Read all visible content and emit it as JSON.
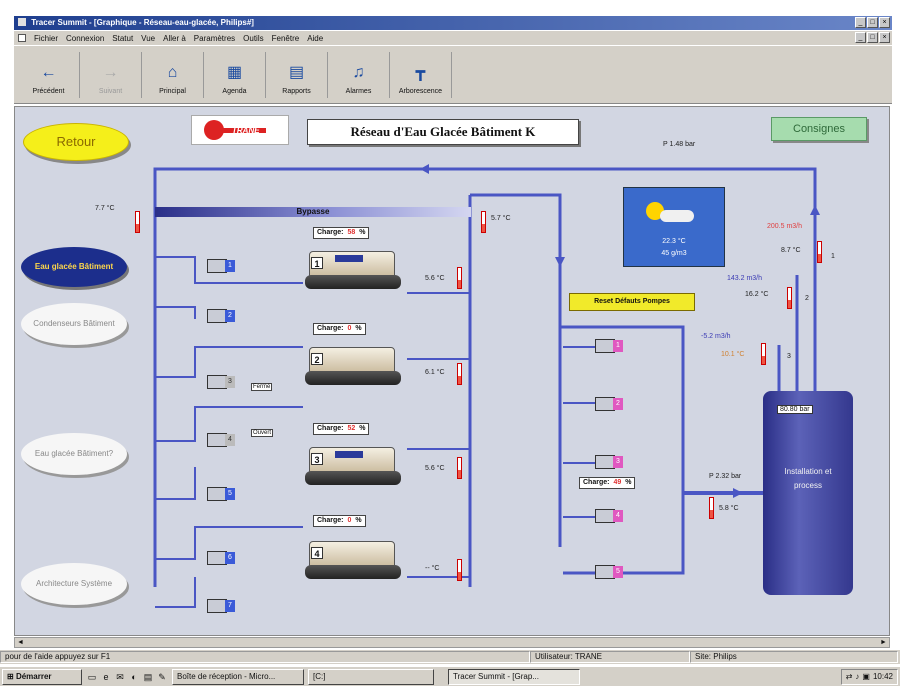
{
  "window": {
    "title": "Tracer Summit - [Graphique - Réseau-eau-glacée, Philips#]",
    "menu": [
      "Fichier",
      "Connexion",
      "Statut",
      "Vue",
      "Aller à",
      "Paramètres",
      "Outils",
      "Fenêtre",
      "Aide"
    ]
  },
  "toolbar": [
    {
      "label": "Précédent",
      "icon": "back-arrow-icon",
      "glyph": "←",
      "enabled": true
    },
    {
      "label": "Suivant",
      "icon": "forward-arrow-icon",
      "glyph": "→",
      "enabled": false
    },
    {
      "label": "Principal",
      "icon": "home-icon",
      "glyph": "⌂",
      "enabled": true
    },
    {
      "label": "Agenda",
      "icon": "agenda-icon",
      "glyph": "▦",
      "enabled": true
    },
    {
      "label": "Rapports",
      "icon": "reports-icon",
      "glyph": "▤",
      "enabled": true
    },
    {
      "label": "Alarmes",
      "icon": "alarm-bell-icon",
      "glyph": "♫",
      "enabled": true
    },
    {
      "label": "Arborescence",
      "icon": "tree-icon",
      "glyph": "┳",
      "enabled": true
    }
  ],
  "nav": {
    "retour": "Retour",
    "eau_glacee_batiment": "Eau glacée Bâtiment",
    "condenseurs_batiment": "Condenseurs Bâtiment",
    "eau_glacee_batiment2": "Eau glacée Bâtiment?",
    "architecture": "Architecture Système"
  },
  "diagram": {
    "logo": "TRANE",
    "title": "Réseau d'Eau Glacée Bâtiment K",
    "consignes": "Consignes",
    "bypass": "Bypasse",
    "reset_button": "Reset Défauts Pompes",
    "top_pressure": "1.48 bar",
    "return_temp": "7.7 °C",
    "supply_temp": "5.7 °C",
    "weather": {
      "temp": "22.3 °C",
      "humidity": "45 g/m3"
    },
    "chillers": [
      {
        "num": "1",
        "charge_label": "Charge:",
        "charge": "58",
        "unit": "%",
        "temp": "5.6 °C"
      },
      {
        "num": "2",
        "charge_label": "Charge:",
        "charge": "0",
        "unit": "%",
        "temp": "6.1 °C"
      },
      {
        "num": "3",
        "charge_label": "Charge:",
        "charge": "52",
        "unit": "%",
        "temp": "5.6 °C"
      },
      {
        "num": "4",
        "charge_label": "Charge:",
        "charge": "0",
        "unit": "%",
        "temp": "-- °C"
      }
    ],
    "secondary_charge": {
      "label": "Charge:",
      "value": "49",
      "unit": "%"
    },
    "flows": [
      {
        "flow": "200.5 m3/h",
        "temp": "8.7 °C",
        "line": "1"
      },
      {
        "flow": "143.2 m3/h",
        "temp": "16.2 °C",
        "line": "2"
      },
      {
        "flow": "-5.2 m3/h",
        "temp": "10.1 °C",
        "line": "3"
      }
    ],
    "tank": {
      "pressure": "2.32 bar",
      "temp": "5.8 °C",
      "level": "80.80 bar",
      "name": "Installation et process"
    },
    "pump_status": [
      "Fermé",
      "Ouvert"
    ]
  },
  "scroll": {
    "left": "◄",
    "right": "►"
  },
  "status": {
    "help": "pour de l'aide appuyez sur F1",
    "user": "Utilisateur: TRANE",
    "site": "Site: Philips"
  },
  "taskbar": {
    "start": "Démarrer",
    "tasks": [
      "Boîte de réception - Micro...",
      "[C:]",
      "Tracer Summit - [Grap..."
    ],
    "clock": "10:42"
  },
  "colors": {
    "pipe_blue": "#4a56c4",
    "pipe_light": "#8a92dc",
    "workspace": "#d2d6e2"
  }
}
